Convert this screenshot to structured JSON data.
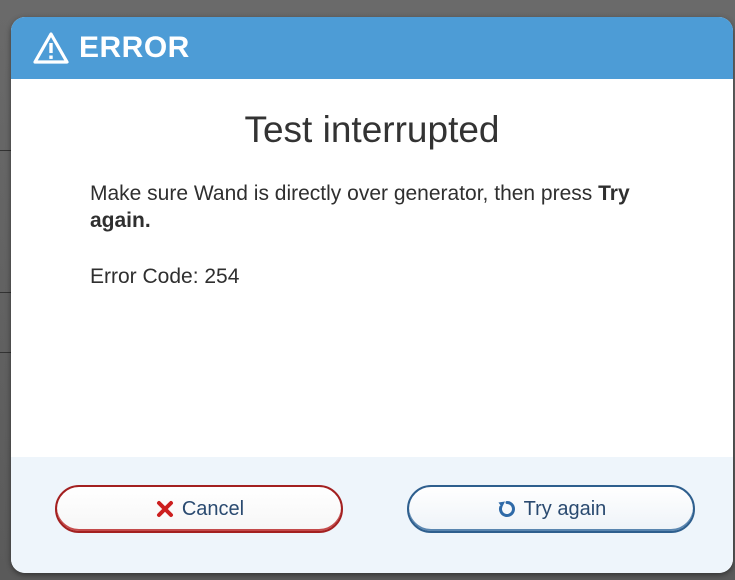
{
  "dialog": {
    "header_title": "ERROR",
    "header_icon": "warning-triangle-icon",
    "message_title": "Test interrupted",
    "message_text_prefix": "Make sure Wand is directly over generator, then press ",
    "message_text_bold": "Try again.",
    "error_code": "Error Code: 254"
  },
  "buttons": {
    "cancel_label": "Cancel",
    "cancel_icon": "x-icon",
    "try_again_label": "Try again",
    "try_again_icon": "retry-icon"
  },
  "colors": {
    "header": "#4d9cd6",
    "cancel_border": "#a32020",
    "cancel_icon": "#cc1f1f",
    "try_again_border": "#2e5f8e",
    "try_again_icon": "#2f6aa8",
    "footer": "#eef5fb"
  }
}
